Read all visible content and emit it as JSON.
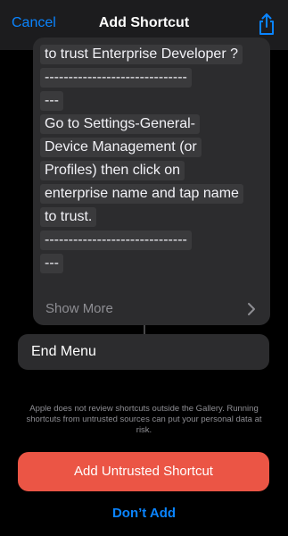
{
  "header": {
    "cancel_label": "Cancel",
    "title": "Add Shortcut",
    "share_icon": "share-icon"
  },
  "text_block": {
    "lines": [
      "to trust Enterprise Developer ?",
      "------------------------------",
      "---",
      "Go to Settings-General-",
      "Device Management (or",
      "Profiles) then click on",
      "enterprise name and tap name",
      "to trust.",
      "------------------------------",
      "---"
    ],
    "show_more_label": "Show More"
  },
  "end_menu": {
    "label": "End Menu"
  },
  "notice": "Apple does not review shortcuts outside the Gallery. Running shortcuts from untrusted sources can put your personal data at risk.",
  "actions": {
    "primary_label": "Add Untrusted Shortcut",
    "secondary_label": "Don’t Add"
  },
  "colors": {
    "accent": "#0a84ff",
    "danger": "#eb5545",
    "card": "#2c2c2e",
    "background": "#000000"
  }
}
